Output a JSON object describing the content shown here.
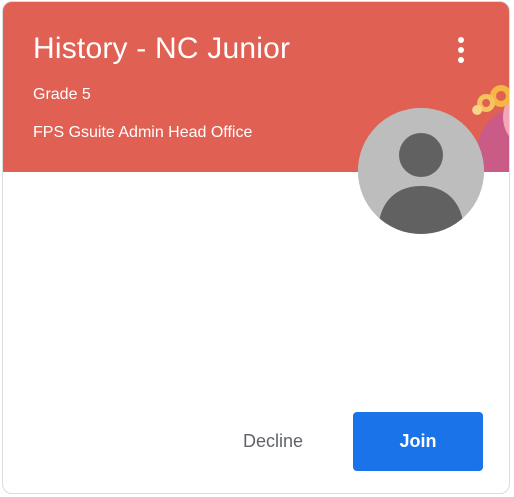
{
  "card": {
    "title": "History - NC Junior",
    "section": "Grade 5",
    "owner": "FPS Gsuite Admin Head Office",
    "header_color": "#e06054"
  },
  "icons": {
    "more": "more-vertical-icon",
    "avatar": "person-icon"
  },
  "actions": {
    "decline_label": "Decline",
    "join_label": "Join",
    "join_color": "#1a73e8"
  }
}
